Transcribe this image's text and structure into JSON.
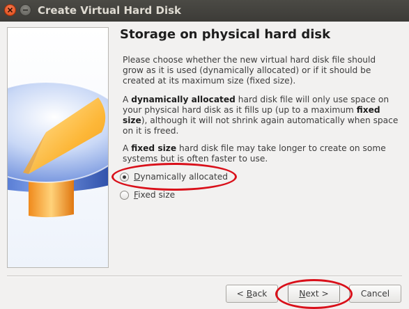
{
  "window": {
    "title": "Create Virtual Hard Disk"
  },
  "titlebar": {
    "close_icon": "close-icon",
    "minimize_icon": "minimize-icon"
  },
  "wizard": {
    "heading": "Storage on physical hard disk",
    "paragraph1": "Please choose whether the new virtual hard disk file should grow as it is used (dynamically allocated) or if it should be created at its maximum size (fixed size).",
    "paragraph2": {
      "part1": "A ",
      "bold1": "dynamically allocated",
      "part2": " hard disk file will only use space on your physical hard disk as it fills up (up to a maximum ",
      "bold2": "fixed size",
      "part3": "), although it will not shrink again automatically when space on it is freed."
    },
    "paragraph3": {
      "part1": "A ",
      "bold1": "fixed size",
      "part2": " hard disk file may take longer to create on some systems but is often faster to use."
    },
    "options": [
      {
        "mnemonic": "D",
        "rest": "ynamically allocated",
        "selected": true
      },
      {
        "mnemonic": "F",
        "rest": "ixed size",
        "selected": false
      }
    ]
  },
  "buttons": {
    "back": {
      "prefix": "< ",
      "mnemonic": "B",
      "rest": "ack"
    },
    "next": {
      "mnemonic": "N",
      "rest": "ext >"
    },
    "cancel": "Cancel"
  },
  "colors": {
    "annotation": "#d9101a",
    "titlebar": "#3c3b37",
    "close_button": "#df4a16"
  }
}
